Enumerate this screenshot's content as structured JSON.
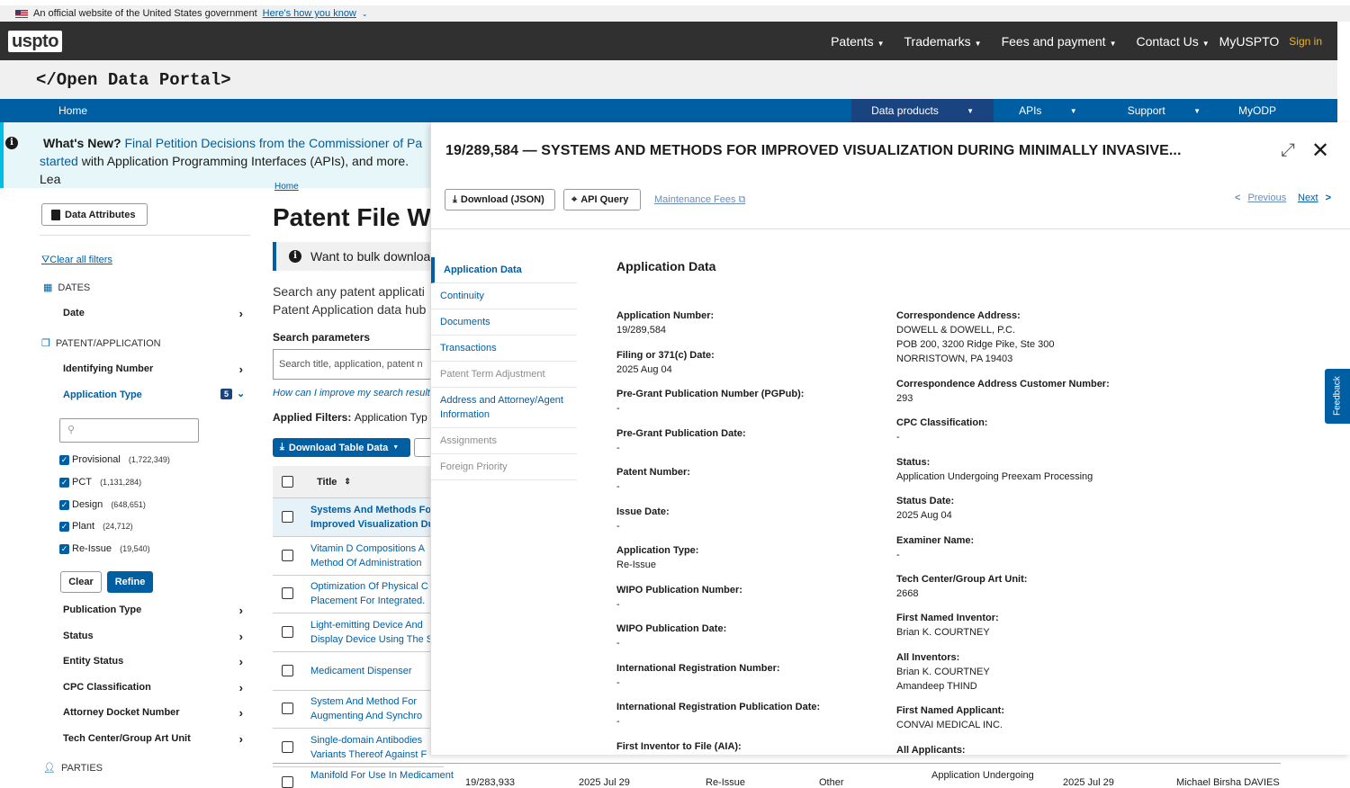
{
  "gov_banner": {
    "text": "An official website of the United States government",
    "link": "Here's how you know"
  },
  "topbar": {
    "logo": "uspto",
    "nav": [
      "Patents",
      "Trademarks",
      "Fees and payment",
      "Contact Us"
    ],
    "myuspto": "MyUSPTO",
    "signin": "Sign in"
  },
  "portal_title": "</Open Data Portal>",
  "bluenav": {
    "home": "Home",
    "items": [
      "Data products",
      "APIs",
      "Support",
      "MyODP"
    ]
  },
  "whats_new": {
    "label": "What's New?",
    "link": "Final Petition Decisions from the Commissioner of Pa",
    "line2_link": "started",
    "line2_text": "with Application Programming Interfaces (APIs), and more. Lea"
  },
  "sidebar": {
    "data_attributes": "Data Attributes",
    "clear_filters": "Clear all filters",
    "dates_header": "DATES",
    "date": "Date",
    "patent_header": "PATENT/APPLICATION",
    "identifying_number": "Identifying Number",
    "application_type": "Application Type",
    "app_type_count": "5",
    "checkboxes": [
      {
        "label": "Provisional",
        "count": "(1,722,349)"
      },
      {
        "label": "PCT",
        "count": "(1,131,284)"
      },
      {
        "label": "Design",
        "count": "(648,651)"
      },
      {
        "label": "Plant",
        "count": "(24,712)"
      },
      {
        "label": "Re-Issue",
        "count": "(19,540)"
      }
    ],
    "clear": "Clear",
    "refine": "Refine",
    "filters": [
      "Publication Type",
      "Status",
      "Entity Status",
      "CPC Classification",
      "Attorney Docket Number",
      "Tech Center/Group Art Unit"
    ],
    "parties": "PARTIES"
  },
  "main": {
    "breadcrumb": "Home",
    "title": "Patent File Wr",
    "bulk": "Want to bulk downloa",
    "search_desc_1": "Search any patent applicati",
    "search_desc_2": "Patent Application data hub",
    "search_params": "Search parameters",
    "search_placeholder": "Search title, application, patent n",
    "improve": "How can I improve my search results",
    "applied_filters": "Applied Filters:",
    "applied_value": "Application Typ",
    "download_table": "Download Table Data",
    "col_title": "Title",
    "rows": [
      [
        "Systems And Methods Fo",
        "Improved Visualization Du"
      ],
      [
        "Vitamin D Compositions A",
        "Method Of Administration"
      ],
      [
        "Optimization Of Physical C",
        "Placement For Integrated."
      ],
      [
        "Light-emitting Device And",
        "Display Device Using The S"
      ],
      [
        "Medicament Dispenser",
        ""
      ],
      [
        "System And Method For",
        "Augmenting And Synchro"
      ],
      [
        "Single-domain Antibodies",
        "Variants Thereof Against F"
      ]
    ]
  },
  "bottom_row": {
    "title": "Manifold For Use In Medicament",
    "app_no": "19/283,933",
    "date": "2025 Jul 29",
    "type": "Re-Issue",
    "entity": "Other",
    "status": "Application Undergoing",
    "date2": "2025 Jul 29",
    "inventor": "Michael Birsha DAVIES"
  },
  "overlay": {
    "title": "19/289,584 — SYSTEMS AND METHODS FOR IMPROVED VISUALIZATION DURING MINIMALLY INVASIVE...",
    "download_json": "Download (JSON)",
    "api_query": "API Query",
    "maintenance": "Maintenance Fees",
    "previous": "Previous",
    "next": "Next",
    "nav": [
      {
        "label": "Application Data",
        "state": "active"
      },
      {
        "label": "Continuity",
        "state": "link"
      },
      {
        "label": "Documents",
        "state": "link"
      },
      {
        "label": "Transactions",
        "state": "link"
      },
      {
        "label": "Patent Term Adjustment",
        "state": "disabled"
      },
      {
        "label": "Address and Attorney/Agent Information",
        "state": "link"
      },
      {
        "label": "Assignments",
        "state": "disabled"
      },
      {
        "label": "Foreign Priority",
        "state": "disabled"
      }
    ],
    "section_title": "Application Data",
    "left_fields": [
      {
        "label": "Application Number:",
        "value": "19/289,584"
      },
      {
        "label": "Filing or 371(c) Date:",
        "value": "2025 Aug 04"
      },
      {
        "label": "Pre-Grant Publication Number (PGPub):",
        "value": "-"
      },
      {
        "label": "Pre-Grant Publication Date:",
        "value": "-"
      },
      {
        "label": "Patent Number:",
        "value": "-"
      },
      {
        "label": "Issue Date:",
        "value": "-"
      },
      {
        "label": "Application Type:",
        "value": "Re-Issue"
      },
      {
        "label": "WIPO Publication Number:",
        "value": "-"
      },
      {
        "label": "WIPO Publication Date:",
        "value": "-"
      },
      {
        "label": "International Registration Number:",
        "value": "-"
      },
      {
        "label": "International Registration Publication Date:",
        "value": "-"
      },
      {
        "label": "First Inventor to File (AIA):",
        "value": ""
      }
    ],
    "right_fields": [
      {
        "label": "Correspondence Address:",
        "lines": [
          "DOWELL & DOWELL, P.C.",
          "POB 200, 3200 Ridge Pike, Ste 300",
          "NORRISTOWN, PA  19403"
        ]
      },
      {
        "label": "Correspondence Address Customer Number:",
        "lines": [
          "293"
        ]
      },
      {
        "label": "CPC Classification:",
        "lines": [
          "-"
        ]
      },
      {
        "label": "Status:",
        "lines": [
          "Application Undergoing Preexam Processing"
        ]
      },
      {
        "label": "Status Date:",
        "lines": [
          "2025 Aug 04"
        ]
      },
      {
        "label": "Examiner Name:",
        "lines": [
          "-"
        ]
      },
      {
        "label": "Tech Center/Group Art Unit:",
        "lines": [
          "2668"
        ]
      },
      {
        "label": "First Named Inventor:",
        "lines": [
          "Brian K. COURTNEY"
        ]
      },
      {
        "label": "All Inventors:",
        "lines": [
          "Brian K. COURTNEY",
          "Amandeep THIND"
        ]
      },
      {
        "label": "First Named Applicant:",
        "lines": [
          "CONVAI MEDICAL INC."
        ]
      },
      {
        "label": "All Applicants:",
        "lines": []
      }
    ]
  },
  "feedback": "Feedback"
}
